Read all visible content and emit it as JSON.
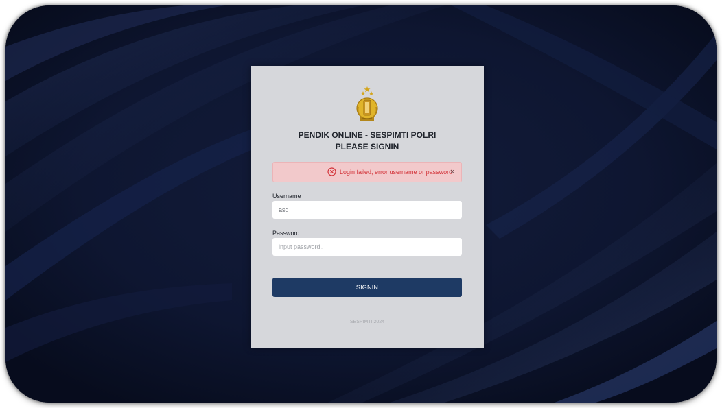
{
  "header": {
    "title": "PENDIK ONLINE - SESPIMTI POLRI",
    "subtitle": "PLEASE SIGNIN"
  },
  "alert": {
    "message": "Login failed, error username or password",
    "close_label": "×",
    "icon": "error-circle-icon",
    "color": "#d3343a",
    "background": "#f2c9cb"
  },
  "form": {
    "username_label": "Username",
    "username_value": "asd",
    "password_label": "Password",
    "password_placeholder": "input password..",
    "password_value": ""
  },
  "signin": {
    "label": "SIGNIN",
    "color": "#1e3a64"
  },
  "footer": {
    "text": "SESPIMTI 2024"
  },
  "logo": {
    "icon": "police-emblem-icon"
  }
}
